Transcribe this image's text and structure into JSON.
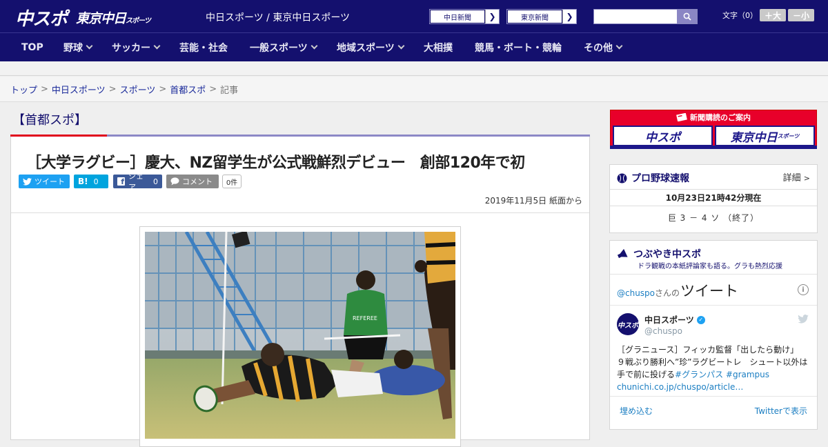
{
  "header": {
    "logo_chuspo": "中スポ",
    "logo_tokyo": "東京中日",
    "logo_tokyo_small": "スポーツ",
    "site_name": "中日スポーツ / 東京中日スポーツ",
    "paper_buttons": [
      "中日新聞",
      "東京新聞"
    ],
    "search_placeholder": "",
    "font_label": "文字（0）",
    "font_up": "＋大",
    "font_down": "－小"
  },
  "nav": {
    "items": [
      "TOP",
      "野球",
      "サッカー",
      "芸能・社会",
      "一般スポーツ",
      "地域スポーツ",
      "大相撲",
      "競馬・ボート・競輪",
      "その他"
    ]
  },
  "breadcrumb": {
    "items": [
      "トップ",
      "中日スポーツ",
      "スポーツ",
      "首都スポ"
    ],
    "current": "記事",
    "sep": ">"
  },
  "section_title": "【首都スポ】",
  "article": {
    "headline": "［大学ラグビー］慶大、NZ留学生が公式戦鮮烈デビュー　創部120年で初",
    "tweet_label": "ツイート",
    "hatena_label": "B!",
    "hatena_count": "0",
    "share_label": "シェア",
    "share_count": "0",
    "comment_label": "コメント",
    "comment_count": "0件",
    "date": "2019年11月5日 紙面から",
    "photo_caption_jersey": "REFEREE"
  },
  "sidebar": {
    "banner_title": "新聞購読のご案内",
    "banner_papers": [
      "中スポ",
      "東京中日"
    ],
    "banner_small": "スポーツ",
    "baseball": {
      "title": "プロ野球速報",
      "detail": "詳細",
      "updated": "10月23日21時42分現在",
      "score": "巨 3 － 4 ソ （終了）"
    },
    "tweets": {
      "title": "つぶやき中スポ",
      "subtitle": "ドラ観戦の本紙評論家も語る。グラも熱烈応援",
      "handle_prefix": "@chuspo",
      "handle_suffix": "さんの",
      "tweet_word": "ツイート",
      "account_name": "中日スポーツ",
      "account_handle": "@chuspo",
      "body_line1": "［グラニュース］フィッカ監督「出したら動け」",
      "body_line2": "９戦ぶり勝利へ”珍”ラグビートレ　シュート以外は",
      "body_line3_text": "手で前に投げる",
      "body_hashtag1": "#グランパス",
      "body_hashtag2": "#grampus",
      "body_link": "chunichi.co.jp/chuspo/article…",
      "embed": "埋め込む",
      "view_on_twitter": "Twitterで表示"
    }
  },
  "colors": {
    "navy": "#14106e",
    "accent_red": "#e0001b",
    "twitter_blue": "#1da1f2",
    "hatena_blue": "#00a4de",
    "facebook_blue": "#3b5998"
  }
}
